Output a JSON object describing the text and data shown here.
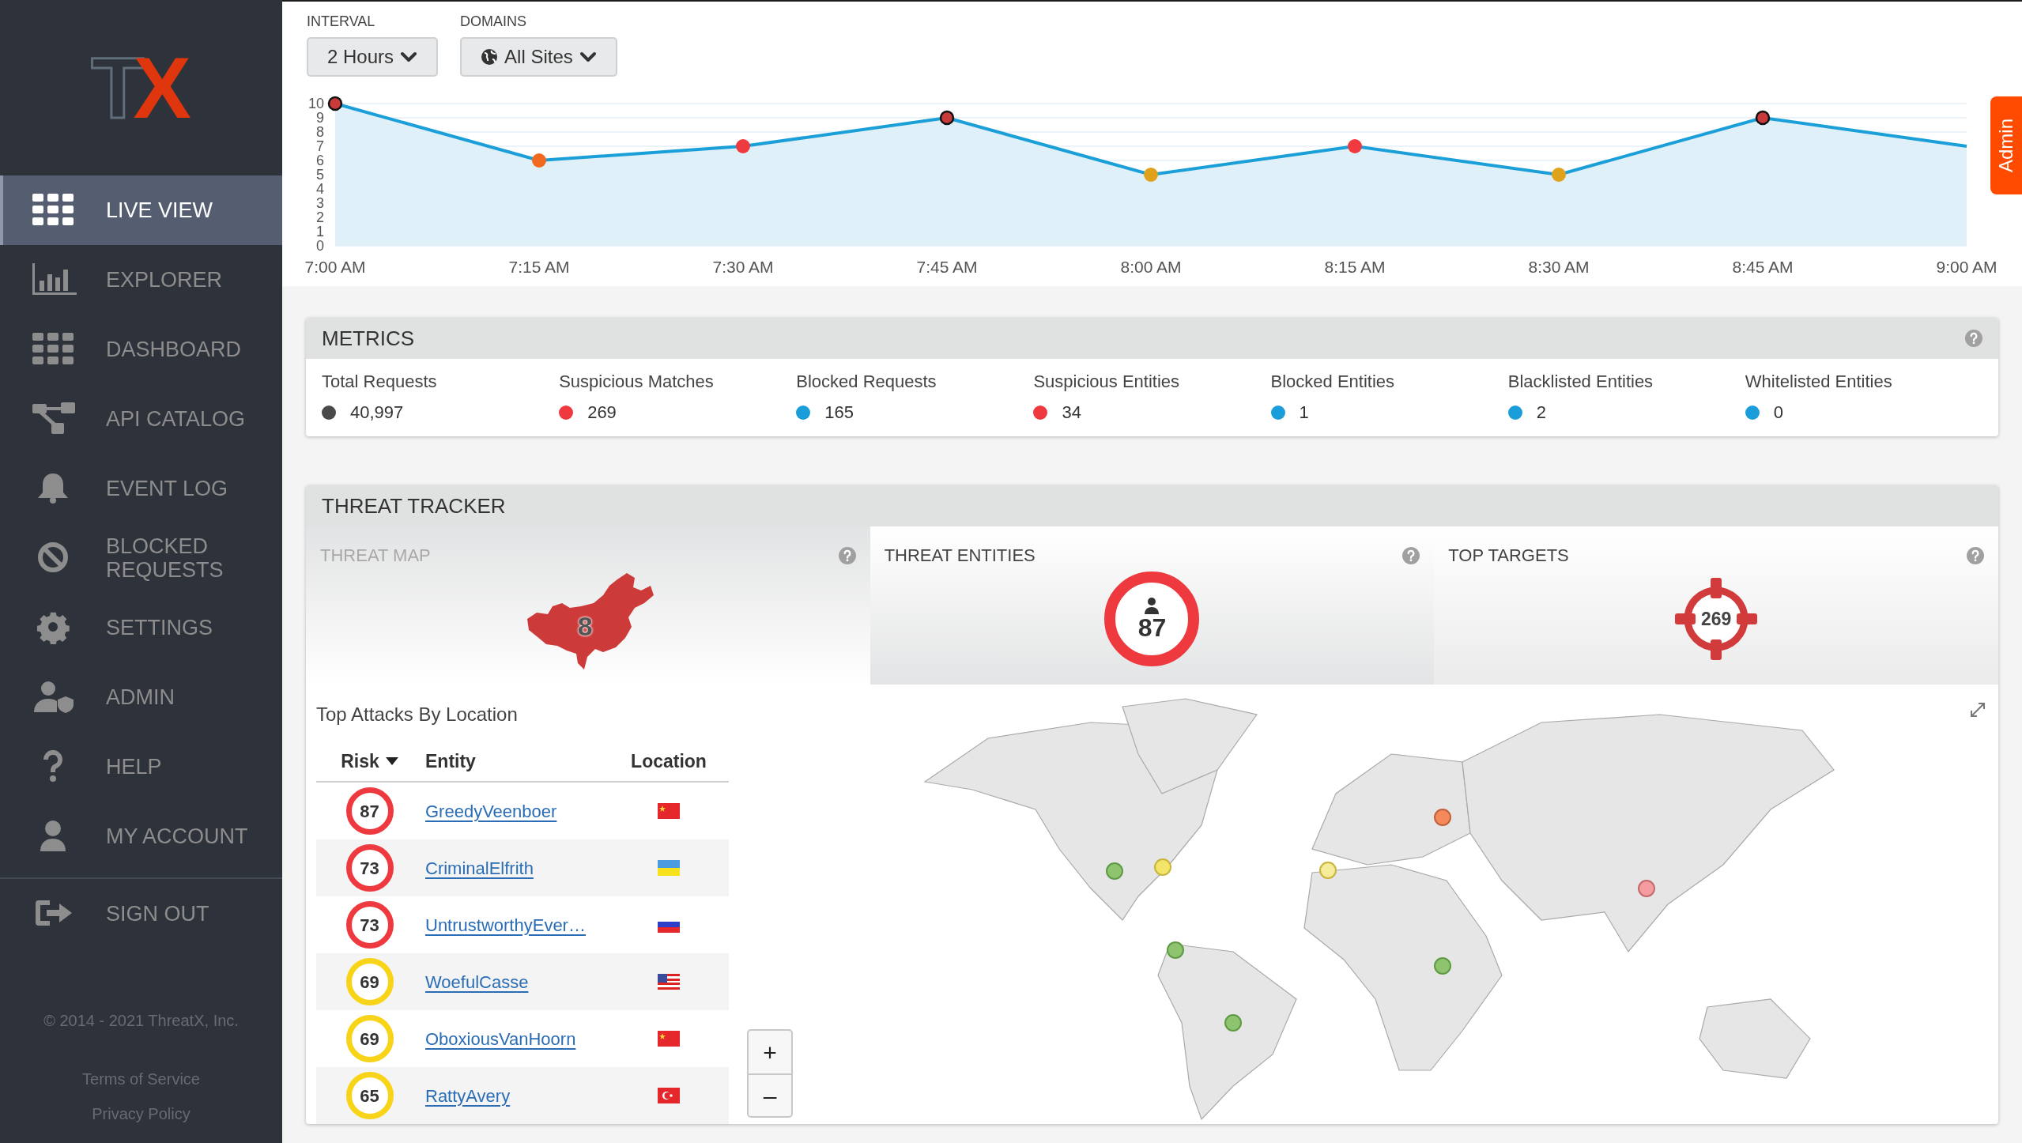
{
  "sidebar": {
    "logo": [
      {
        "text": "T",
        "kind": "outline"
      },
      {
        "text": "X",
        "kind": "solid"
      }
    ],
    "items": [
      {
        "label": "LIVE VIEW",
        "selected": true
      },
      {
        "label": "EXPLORER",
        "selected": false
      },
      {
        "label": "DASHBOARD",
        "selected": false
      },
      {
        "label": "API CATALOG",
        "selected": false
      },
      {
        "label": "EVENT LOG",
        "selected": false
      },
      {
        "label": "BLOCKED REQUESTS",
        "selected": false
      },
      {
        "label": "SETTINGS",
        "selected": false
      },
      {
        "label": "ADMIN",
        "selected": false
      },
      {
        "label": "HELP",
        "selected": false
      },
      {
        "label": "MY ACCOUNT",
        "selected": false
      }
    ],
    "sign_out": {
      "label": "SIGN OUT"
    },
    "footer": {
      "copyright": "© 2014 - 2021 ThreatX, Inc.",
      "links": [
        "Terms of Service",
        "Privacy Policy"
      ]
    }
  },
  "filters": [
    {
      "label": "INTERVAL",
      "value": "2 Hours",
      "kind": "plain"
    },
    {
      "label": "DOMAINS",
      "value": "All Sites",
      "kind": "globe"
    }
  ],
  "chart": {
    "chart_data": {
      "type": "area",
      "categories": [
        "7:00 AM",
        "7:15 AM",
        "7:30 AM",
        "7:45 AM",
        "8:00 AM",
        "8:15 AM",
        "8:30 AM",
        "8:45 AM",
        "9:00 AM"
      ],
      "series": [
        {
          "color": "#1a9fd8",
          "values": [
            10,
            6,
            7,
            9,
            5,
            7,
            5,
            9,
            7
          ]
        }
      ],
      "ylim": [
        0,
        10
      ],
      "yticks": [
        0,
        1,
        2,
        3,
        4,
        5,
        6,
        7,
        8,
        9,
        10
      ],
      "grid": true
    },
    "point_markers": [
      {
        "color": "#c93b3b",
        "outlined": true
      },
      {
        "color": "#f26a1f",
        "outlined": false
      },
      {
        "color": "#ef3a3f",
        "outlined": false
      },
      {
        "color": "#c93b3b",
        "outlined": true
      },
      {
        "color": "#e0a11b",
        "outlined": false
      },
      {
        "color": "#ef3a3f",
        "outlined": false
      },
      {
        "color": "#e0a11b",
        "outlined": false
      },
      {
        "color": "#c93b3b",
        "outlined": true
      }
    ]
  },
  "admin_tab": {
    "label": "Admin"
  },
  "metrics": {
    "title": "METRICS",
    "items": [
      {
        "label": "Total Requests",
        "value": "40,997",
        "color": "#4a4a4a"
      },
      {
        "label": "Suspicious Matches",
        "value": "269",
        "color": "#ee3a3f"
      },
      {
        "label": "Blocked Requests",
        "value": "165",
        "color": "#1a9dd9"
      },
      {
        "label": "Suspicious Entities",
        "value": "34",
        "color": "#ee3a3f"
      },
      {
        "label": "Blocked Entities",
        "value": "1",
        "color": "#1a9dd9"
      },
      {
        "label": "Blacklisted Entities",
        "value": "2",
        "color": "#1a9dd9"
      },
      {
        "label": "Whitelisted Entities",
        "value": "0",
        "color": "#1a9dd9"
      }
    ]
  },
  "threat_tracker": {
    "title": "THREAT TRACKER",
    "panels": [
      {
        "kind": "map",
        "title": "THREAT MAP",
        "count": "8"
      },
      {
        "kind": "entities",
        "title": "THREAT ENTITIES",
        "count": "87"
      },
      {
        "kind": "targets",
        "title": "TOP TARGETS",
        "count": "269"
      }
    ],
    "top_attacks": {
      "title": "Top Attacks By Location",
      "columns": [
        "Risk",
        "Entity",
        "Location"
      ],
      "rows": [
        {
          "risk": "87",
          "color": "#ee3a3f",
          "entity": "GreedyVeenboer",
          "kind": "cn"
        },
        {
          "risk": "73",
          "color": "#ee3a3f",
          "entity": "CriminalElfrith",
          "kind": "ua"
        },
        {
          "risk": "73",
          "color": "#ee3a3f",
          "entity": "UntrustworthyEver…",
          "kind": "ru"
        },
        {
          "risk": "69",
          "color": "#f7d417",
          "entity": "WoefulCasse",
          "kind": "us"
        },
        {
          "risk": "69",
          "color": "#f7d417",
          "entity": "OboxiousVanHoorn",
          "kind": "cn"
        },
        {
          "risk": "65",
          "color": "#f7d417",
          "entity": "RattyAvery",
          "kind": "tr"
        }
      ]
    },
    "map": {
      "kind": "picture",
      "zoom_controls": [
        "+",
        "–"
      ]
    }
  }
}
